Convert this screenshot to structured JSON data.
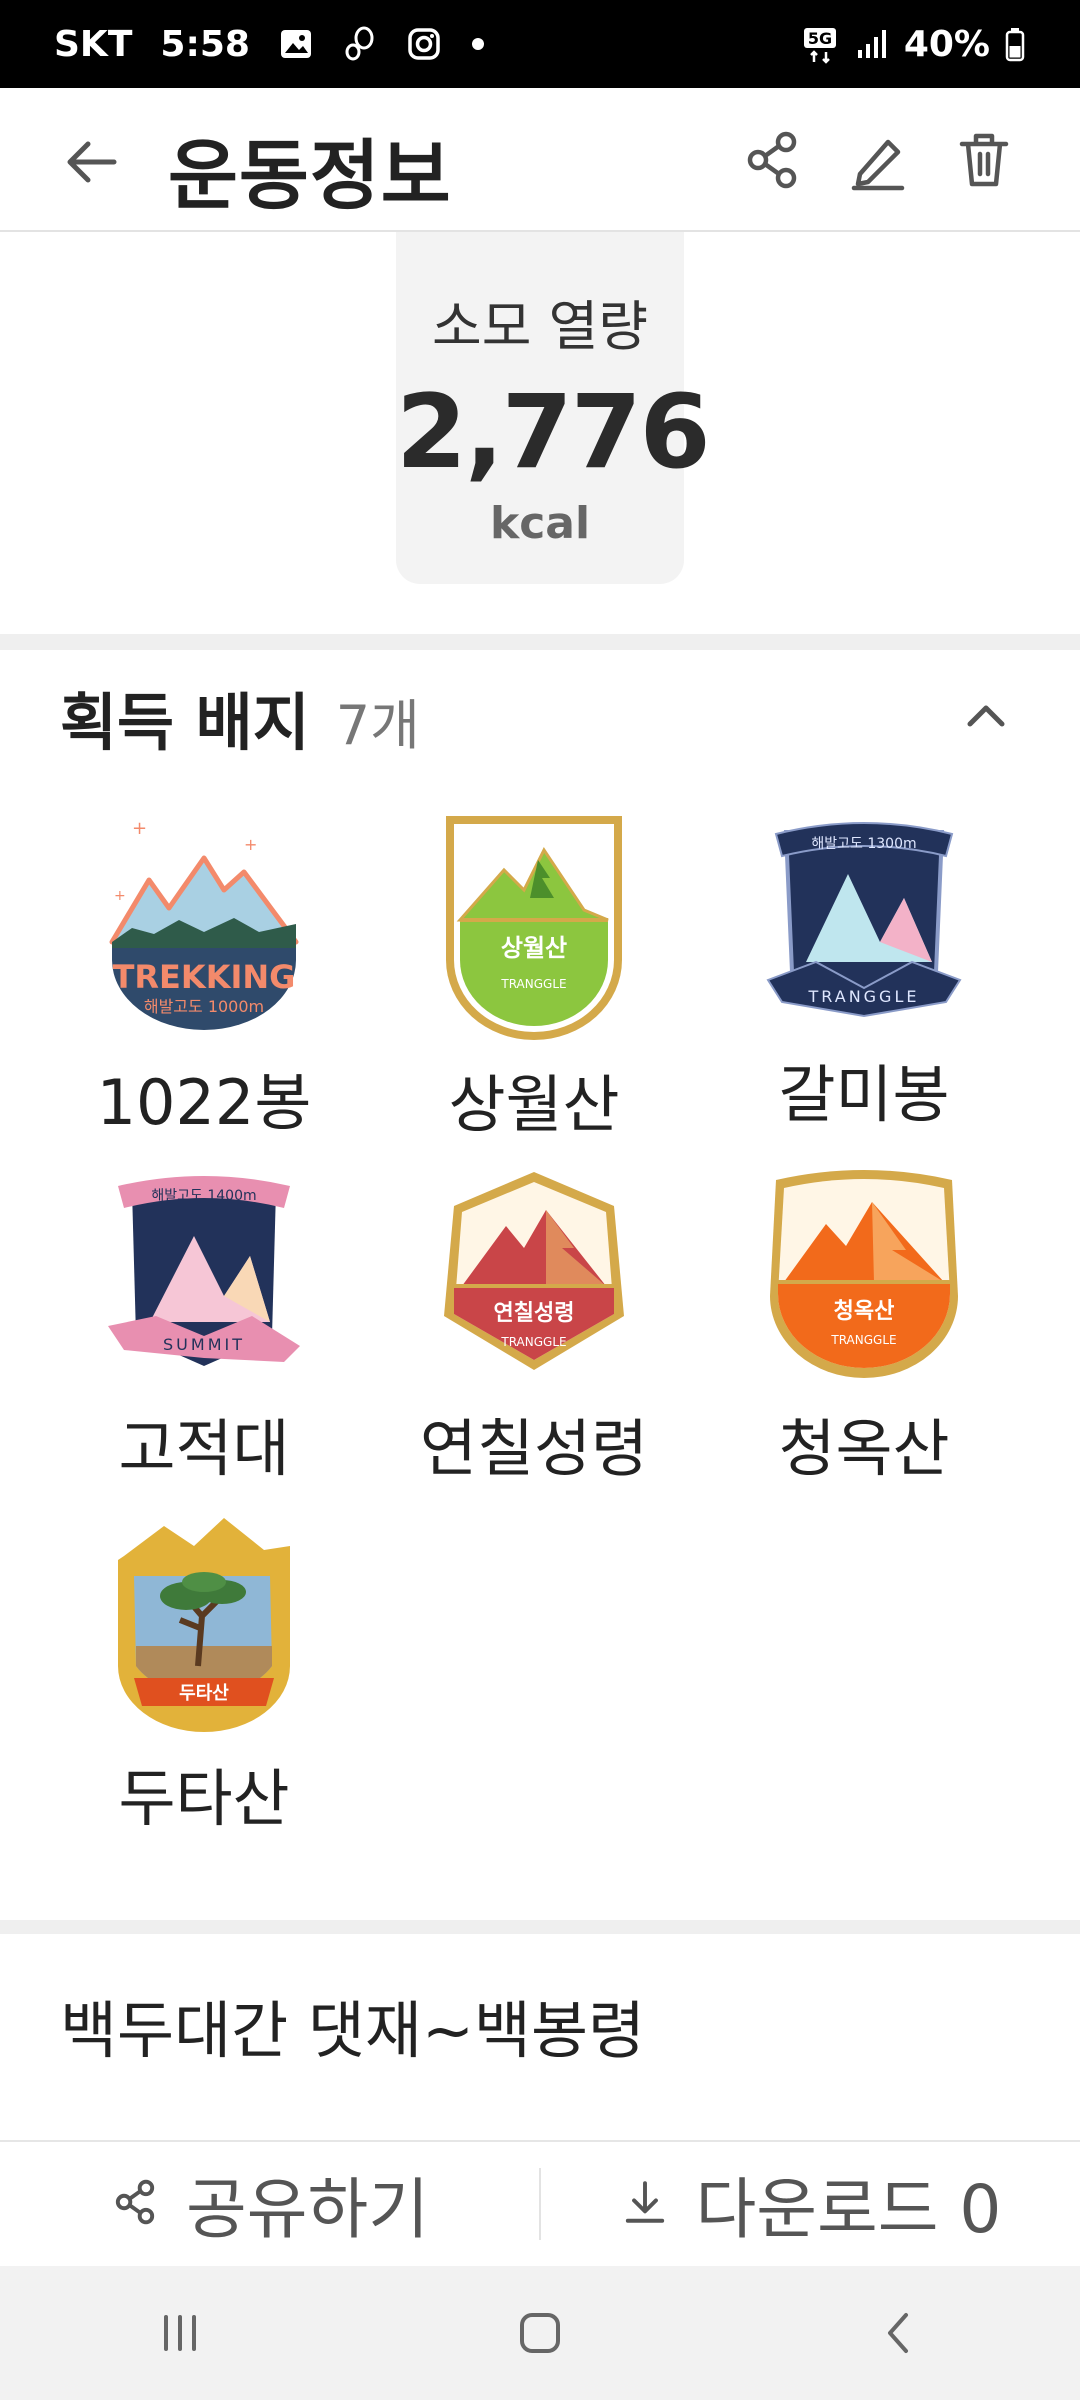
{
  "status_bar": {
    "carrier": "SKT",
    "time": "5:58",
    "network": "5G",
    "battery": "40%"
  },
  "app_bar": {
    "title": "운동정보",
    "icons": [
      "back-arrow-icon",
      "share-icon",
      "edit-icon",
      "trash-icon"
    ]
  },
  "calorie": {
    "label": "소모 열량",
    "value": "2,776",
    "unit": "kcal"
  },
  "badges_section": {
    "title": "획득 배지",
    "count": "7개",
    "items": [
      {
        "name": "1022봉",
        "ribbon": "TREKKING",
        "sub": "해발고도 1000m"
      },
      {
        "name": "상월산",
        "ribbon": "상월산",
        "sub": "TRANGGLE"
      },
      {
        "name": "갈미봉",
        "ribbon": "TRANGGLE",
        "sub": "해발고도 1300m"
      },
      {
        "name": "고적대",
        "ribbon": "SUMMIT",
        "sub": "해발고도 1400m"
      },
      {
        "name": "연칠성령",
        "ribbon": "연칠성령",
        "sub": "TRANGGLE"
      },
      {
        "name": "청옥산",
        "ribbon": "청옥산",
        "sub": "TRANGGLE"
      },
      {
        "name": "두타산",
        "ribbon": "두타산"
      }
    ]
  },
  "route": {
    "title": "백두대간 댓재~백봉령"
  },
  "bottom_actions": {
    "share_label": "공유하기",
    "download_label": "다운로드 0"
  },
  "colors": {
    "trekking_navy": "#2f4a6b",
    "trekking_orange": "#f38a6b",
    "sangwol_green": "#8cc63f",
    "gold": "#d4a94a",
    "galmi_navy": "#22325a",
    "gojeok_pink": "#e88fb0",
    "yeonchil_red": "#c94548",
    "cheongok_orange": "#f26a1b",
    "duta_gold": "#e2b23a"
  }
}
